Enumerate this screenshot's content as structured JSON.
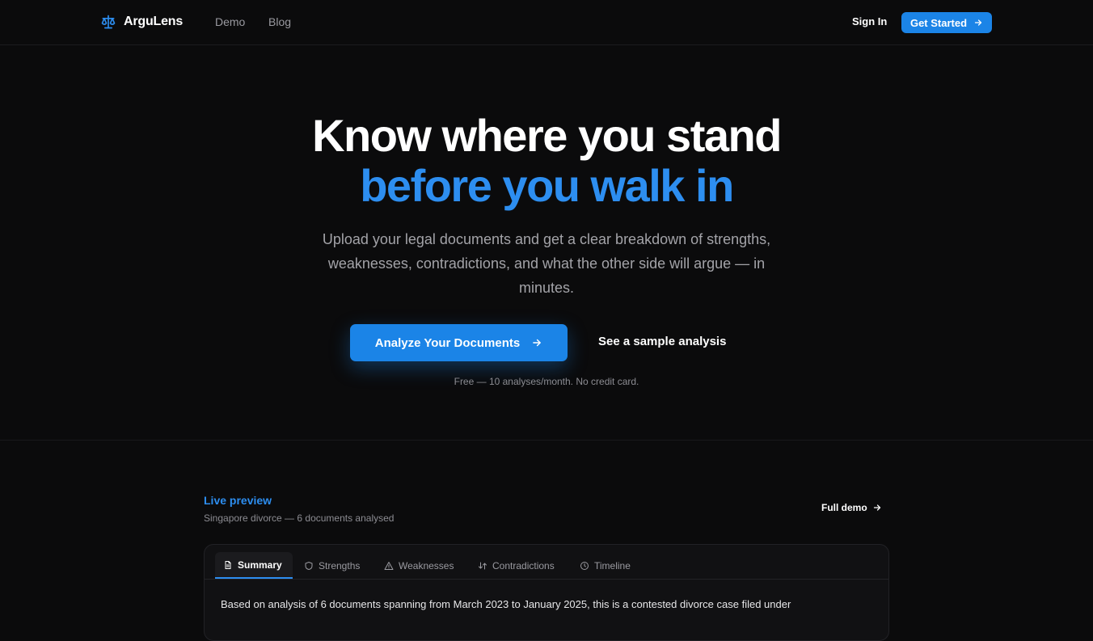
{
  "nav": {
    "brand": "ArguLens",
    "links": [
      "Demo",
      "Blog"
    ],
    "sign_in": "Sign In",
    "get_started": "Get Started"
  },
  "hero": {
    "title_line1": "Know where you stand",
    "title_line2": "before you walk in",
    "subtitle": "Upload your legal documents and get a clear breakdown of strengths, weaknesses, contradictions, and what the other side will argue — in minutes.",
    "cta_primary": "Analyze Your Documents",
    "cta_secondary": "See a sample analysis",
    "note": "Free — 10 analyses/month. No credit card."
  },
  "preview": {
    "label": "Live preview",
    "sublabel": "Singapore divorce — 6 documents analysed",
    "full_demo": "Full demo",
    "tabs": [
      {
        "label": "Summary",
        "icon": "document-icon",
        "active": true
      },
      {
        "label": "Strengths",
        "icon": "shield-icon",
        "active": false
      },
      {
        "label": "Weaknesses",
        "icon": "warning-icon",
        "active": false
      },
      {
        "label": "Contradictions",
        "icon": "swap-icon",
        "active": false
      },
      {
        "label": "Timeline",
        "icon": "clock-icon",
        "active": false
      }
    ],
    "summary_text": "Based on analysis of 6 documents spanning from March 2023 to January 2025, this is a contested divorce case filed under"
  },
  "colors": {
    "accent": "#1b84e7",
    "accent_text": "#2d8ef0",
    "background": "#0b0b0c"
  }
}
